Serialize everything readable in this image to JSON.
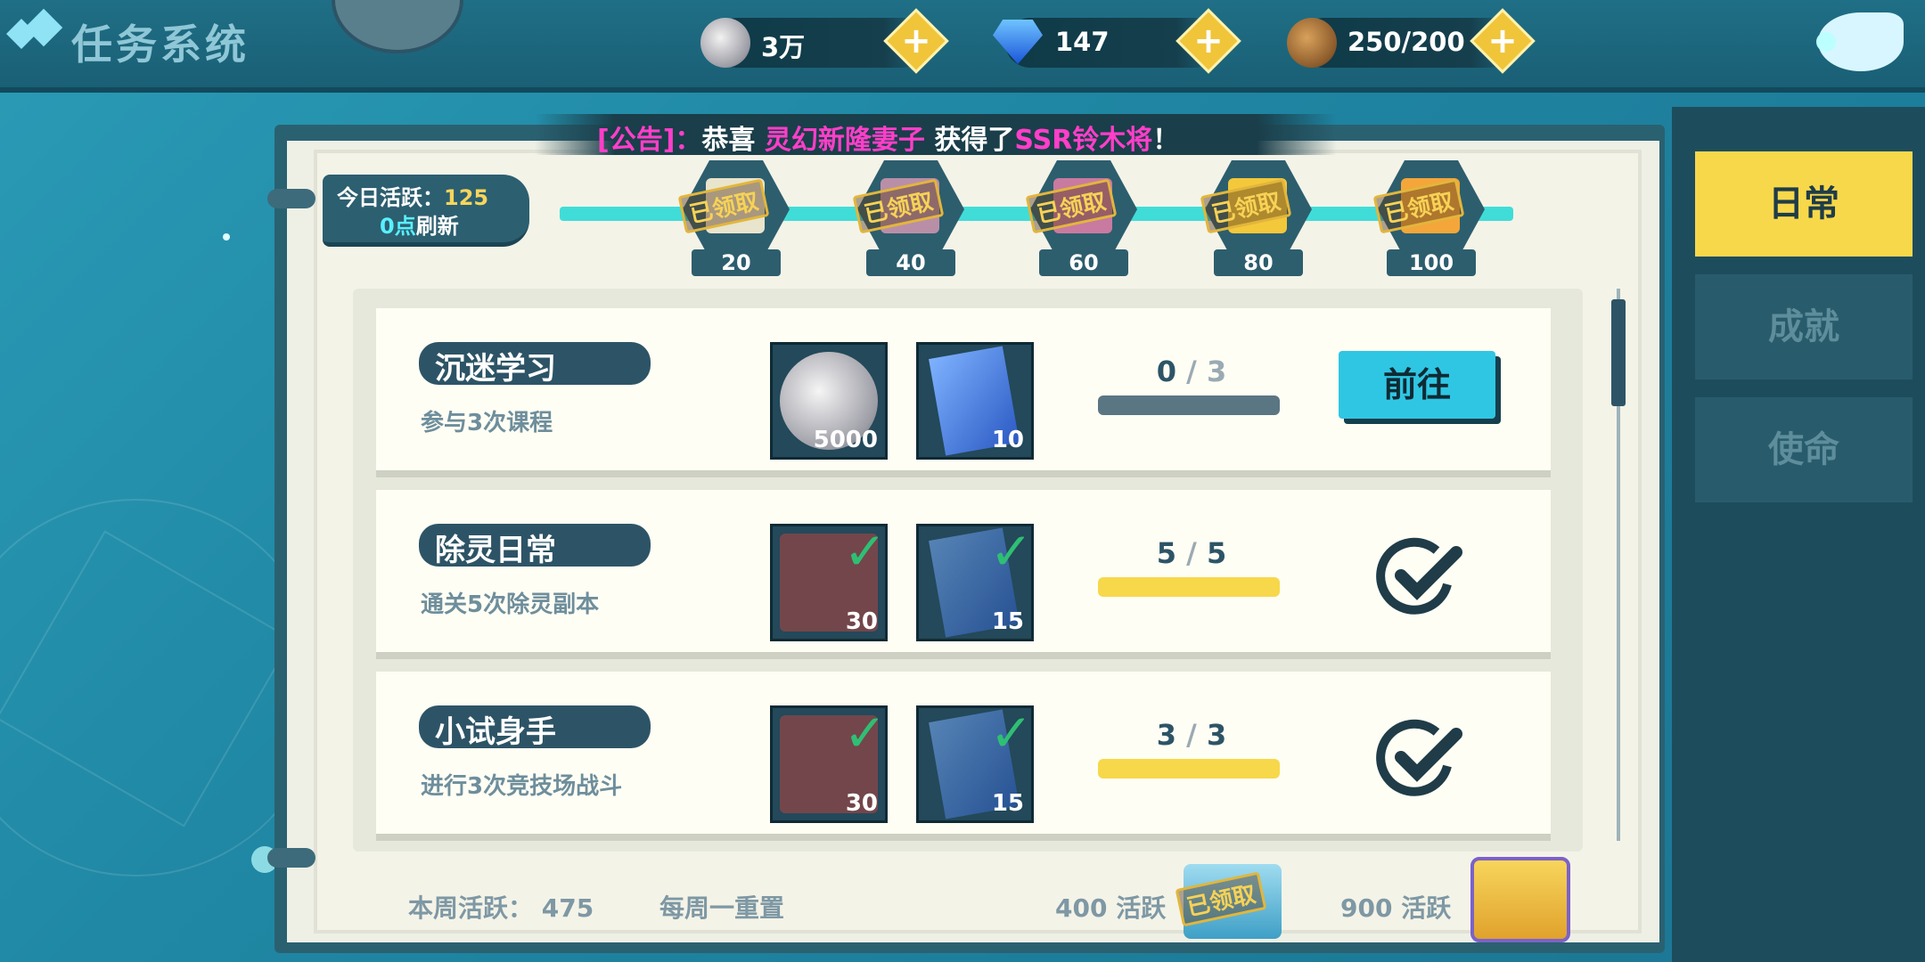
{
  "header": {
    "title": "任务系统",
    "currencies": [
      {
        "icon": "silver-coin-icon",
        "value": "3万"
      },
      {
        "icon": "blue-diamond-icon",
        "value": "147"
      },
      {
        "icon": "stamina-cookie-icon",
        "value": "250/200"
      }
    ]
  },
  "notice": {
    "prefix": "[公告]：",
    "text1": "恭喜 ",
    "player": "灵幻新隆妻子",
    "text2": " 获得了",
    "reward": "SSR铃木将",
    "suffix": "！"
  },
  "activity": {
    "label": "今日活跃：",
    "value": "125",
    "refresh_time": "0点",
    "refresh_label": "刷新",
    "milestones": [
      {
        "points": "20",
        "status": "已领取"
      },
      {
        "points": "40",
        "status": "已领取"
      },
      {
        "points": "60",
        "status": "已领取"
      },
      {
        "points": "80",
        "status": "已领取"
      },
      {
        "points": "100",
        "status": "已领取"
      }
    ]
  },
  "tasks": [
    {
      "name": "沉迷学习",
      "desc": "参与3次课程",
      "rewards": [
        {
          "icon": "silver-coin-icon",
          "count": "5000"
        },
        {
          "icon": "blue-card-icon",
          "count": "10"
        }
      ],
      "progress_current": "0",
      "progress_sep": "/",
      "progress_total": "3",
      "progress_fraction": 0.0,
      "action": "前往",
      "done": false
    },
    {
      "name": "除灵日常",
      "desc": "通关5次除灵副本",
      "rewards": [
        {
          "icon": "exp-book-icon",
          "count": "30"
        },
        {
          "icon": "blue-card-icon",
          "count": "15"
        }
      ],
      "progress_current": "5",
      "progress_sep": "/",
      "progress_total": "5",
      "progress_fraction": 1.0,
      "action": "",
      "done": true
    },
    {
      "name": "小试身手",
      "desc": "进行3次竞技场战斗",
      "rewards": [
        {
          "icon": "exp-book-icon",
          "count": "30"
        },
        {
          "icon": "blue-card-icon",
          "count": "15"
        }
      ],
      "progress_current": "3",
      "progress_sep": "/",
      "progress_total": "3",
      "progress_fraction": 1.0,
      "action": "",
      "done": true
    }
  ],
  "tabs": [
    {
      "label": "日常",
      "active": true
    },
    {
      "label": "成就",
      "active": false
    },
    {
      "label": "使命",
      "active": false
    }
  ],
  "weekly": {
    "label": "本周活跃：",
    "value": "475",
    "reset": "每周一重置",
    "tier1_points": "400",
    "tier1_unit": "活跃",
    "tier1_status": "已领取",
    "tier2_points": "900",
    "tier2_unit": "活跃"
  },
  "colors": {
    "accent_yellow": "#f7d84a",
    "accent_cyan": "#2fc6e3",
    "dark_teal": "#2d5466",
    "magenta": "#ff3ec9"
  }
}
